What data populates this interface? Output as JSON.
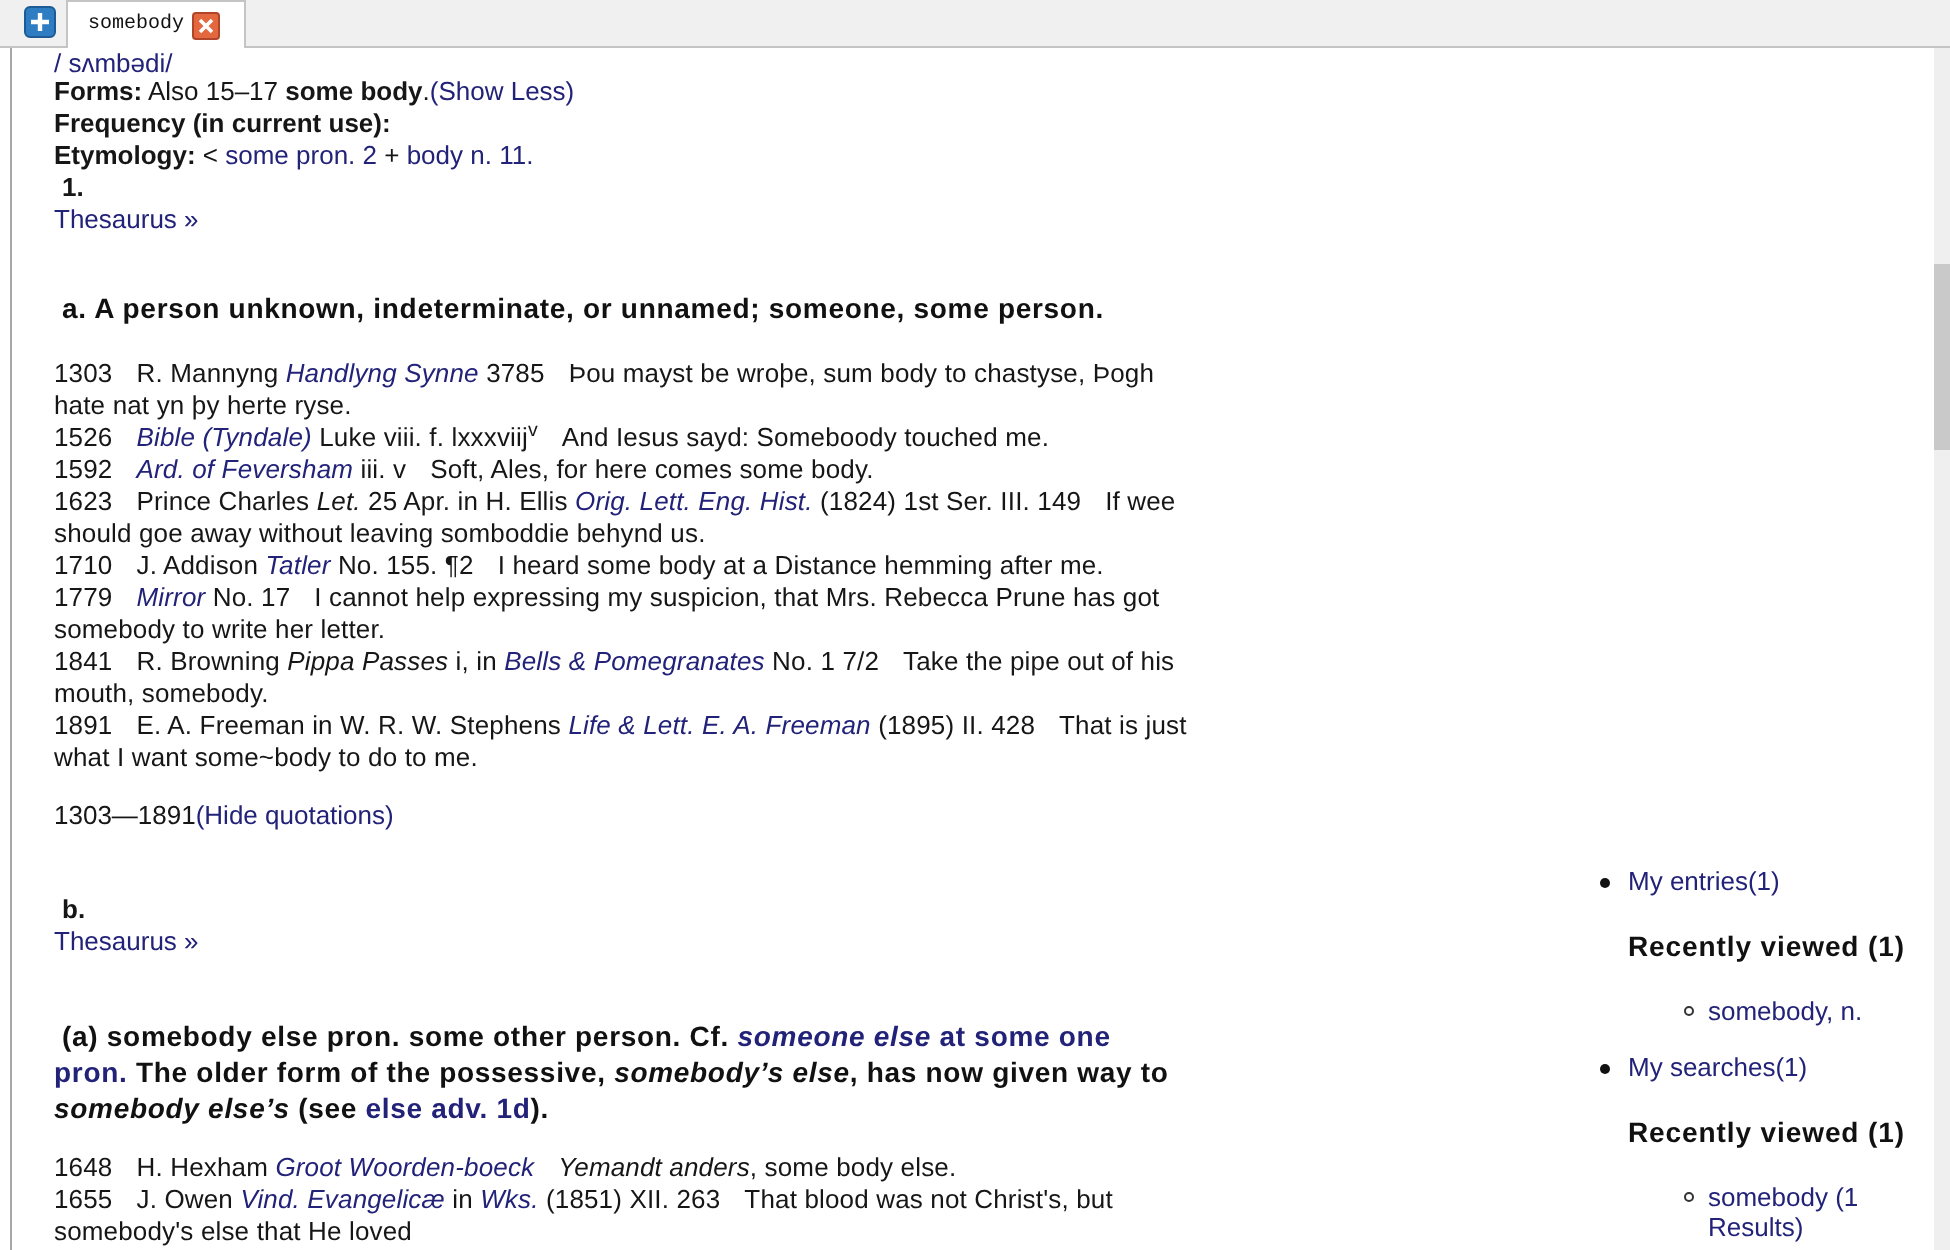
{
  "tabs": [
    {
      "label": "somebody",
      "selected": true
    }
  ],
  "entry": {
    "pronunciation": "/ sʌmbədi/",
    "info_lines": [
      [
        {
          "kind": "label",
          "text": "Forms:"
        },
        {
          "kind": "text",
          "text": " Also 15–17 **some body**."
        },
        {
          "kind": "link",
          "text": "(Show Less)"
        }
      ],
      [
        {
          "kind": "label",
          "text": "Frequency (in current use):"
        }
      ],
      [
        {
          "kind": "label",
          "text": "Etymology:"
        },
        {
          "kind": "text",
          "text": " < "
        },
        {
          "kind": "link",
          "text": "some pron. 2"
        },
        {
          "kind": "text",
          "text": " + "
        },
        {
          "kind": "link",
          "text": "body n. 11."
        }
      ]
    ],
    "senses": [
      {
        "number": "1.",
        "thesaurus": "Thesaurus »",
        "definition": [
          {
            "kind": "text",
            "text": "a. A person unknown, indeterminate, or unnamed; someone, some person."
          }
        ],
        "quotations": [
          {
            "date": "1303",
            "citation": [
              {
                "kind": "text",
                "text": "R. Mannyng "
              },
              {
                "kind": "italic_link",
                "text": "Handlyng Synne"
              },
              {
                "kind": "text",
                "text": " 3785"
              }
            ],
            "text": "Þou mayst be wroþe, sum body to chastyse, Þogh hate nat yn þy herte ryse."
          },
          {
            "date": "1526",
            "citation": [
              {
                "kind": "italic_link",
                "text": "Bible (Tyndale)"
              },
              {
                "kind": "text",
                "text": " Luke viii. f. lxxxviij$^{v}$"
              }
            ],
            "text": "And Iesus sayd: Someboody touched me."
          },
          {
            "date": "1592",
            "citation": [
              {
                "kind": "italic_link",
                "text": "Ard. of Feversham"
              },
              {
                "kind": "text",
                "text": " iii. v"
              }
            ],
            "text": "Soft, Ales, for here comes some body."
          },
          {
            "date": "1623",
            "citation": [
              {
                "kind": "text",
                "text": "Prince Charles *Let.* 25 Apr. in H. Ellis "
              },
              {
                "kind": "italic_link",
                "text": "Orig. Lett. Eng. Hist."
              },
              {
                "kind": "text",
                "text": " (1824) 1st Ser. III. 149"
              }
            ],
            "text": "If wee should goe away without leaving somboddie behynd us."
          },
          {
            "date": "1710",
            "citation": [
              {
                "kind": "text",
                "text": "J. Addison "
              },
              {
                "kind": "italic_link",
                "text": "Tatler"
              },
              {
                "kind": "text",
                "text": " No. 155. ¶2"
              }
            ],
            "text": "I heard some body at a Distance hemming after me."
          },
          {
            "date": "1779",
            "citation": [
              {
                "kind": "italic_link",
                "text": "Mirror"
              },
              {
                "kind": "text",
                "text": " No. 17"
              }
            ],
            "text": "I cannot help expressing my suspicion, that Mrs. Rebecca Prune has got somebody to write her letter."
          },
          {
            "date": "1841",
            "citation": [
              {
                "kind": "text",
                "text": "R. Browning *Pippa Passes* i, in "
              },
              {
                "kind": "italic_link",
                "text": "Bells & Pomegranates"
              },
              {
                "kind": "text",
                "text": " No. 1 7/2"
              }
            ],
            "text": "Take the pipe out of his mouth, somebody."
          },
          {
            "date": "1891",
            "citation": [
              {
                "kind": "text",
                "text": "E. A. Freeman in W. R. W. Stephens "
              },
              {
                "kind": "italic_link",
                "text": "Life & Lett. E. A. Freeman"
              },
              {
                "kind": "text",
                "text": " (1895) II. 428"
              }
            ],
            "text": "That is just what I want some~body to do to me."
          }
        ],
        "date_range": "1303—1891",
        "quotations_toggle": "(Hide quotations)"
      },
      {
        "number": "b.",
        "thesaurus": "Thesaurus »",
        "definition": [
          {
            "kind": "text",
            "text": "(a) somebody else pron. some other person. Cf. "
          },
          {
            "kind": "italic_link",
            "text": "someone else"
          },
          {
            "kind": "link",
            "text": "at some one"
          },
          {
            "kind": "link",
            "text": "pron."
          },
          {
            "kind": "text",
            "text": " The older form of the possessive, *somebody’s else*, has now given way to *somebody else’s* (see "
          },
          {
            "kind": "link",
            "text": "else adv. 1d"
          },
          {
            "kind": "text",
            "text": ")."
          }
        ],
        "quotations": [
          {
            "date": "1648",
            "citation": [
              {
                "kind": "text",
                "text": "H. Hexham "
              },
              {
                "kind": "italic_link",
                "text": "Groot Woorden-boeck"
              }
            ],
            "text": "*Yemandt anders*, some body else."
          },
          {
            "date": "1655",
            "citation": [
              {
                "kind": "text",
                "text": "J. Owen "
              },
              {
                "kind": "italic_link",
                "text": "Vind. Evangelicæ"
              },
              {
                "kind": "text",
                "text": " in "
              },
              {
                "kind": "italic_link",
                "text": "Wks."
              },
              {
                "kind": "text",
                "text": " (1851) XII. 263"
              }
            ],
            "text": "That blood was not Christ's, but somebody's else that He loved"
          }
        ]
      }
    ]
  },
  "sidebar": {
    "groups": [
      {
        "link": "My entries(1)",
        "heading": "Recently viewed (1)",
        "items": [
          "somebody, n."
        ]
      },
      {
        "link": "My searches(1)",
        "heading": "Recently viewed (1)",
        "items": [
          "somebody (1 Results)"
        ]
      }
    ]
  }
}
